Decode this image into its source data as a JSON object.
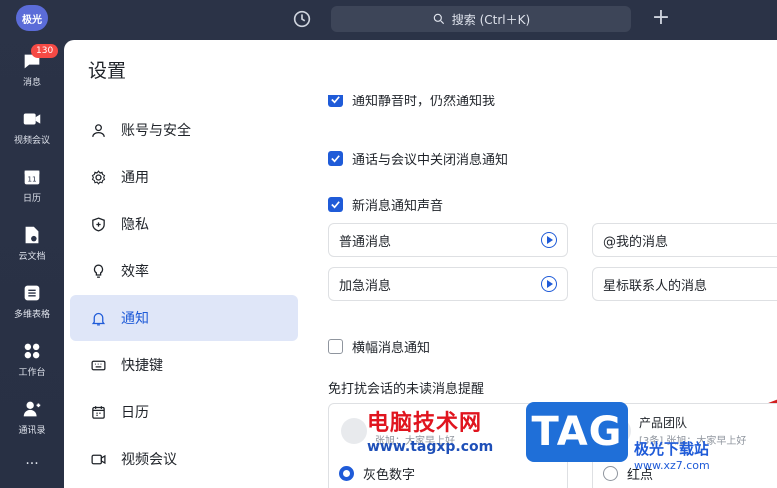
{
  "rail": {
    "avatar": "极光",
    "badge": "130",
    "items": [
      {
        "label": "消息",
        "icon": "chat-bubble-icon"
      },
      {
        "label": "视频会议",
        "icon": "video-camera-icon"
      },
      {
        "label": "日历",
        "icon": "calendar-icon"
      },
      {
        "label": "云文档",
        "icon": "cloud-doc-icon"
      },
      {
        "label": "多维表格",
        "icon": "table-icon"
      },
      {
        "label": "工作台",
        "icon": "grid-apps-icon"
      },
      {
        "label": "通讯录",
        "icon": "contacts-icon"
      },
      {
        "label": "···",
        "icon": "more-icon"
      }
    ]
  },
  "topbar": {
    "search_placeholder": "搜索 (Ctrl＋K)",
    "plus": "+"
  },
  "window": {
    "title": "设置",
    "nav": [
      {
        "label": "账号与安全",
        "icon": "person-icon"
      },
      {
        "label": "通用",
        "icon": "gear-icon"
      },
      {
        "label": "隐私",
        "icon": "shield-icon"
      },
      {
        "label": "效率",
        "icon": "bulb-icon"
      },
      {
        "label": "通知",
        "icon": "bell-icon",
        "active": true
      },
      {
        "label": "快捷键",
        "icon": "keyboard-icon"
      },
      {
        "label": "日历",
        "icon": "calendar-icon"
      },
      {
        "label": "视频会议",
        "icon": "video-camera-icon"
      }
    ],
    "content": {
      "option_cut": "通知静音时，仍然通知我",
      "option_call": "通话与会议中关闭消息通知",
      "option_sound": "新消息通知声音",
      "sounds": [
        "普通消息",
        "@我的消息",
        "加急消息",
        "星标联系人的消息"
      ],
      "option_banner": "横幅消息通知",
      "dnd_label": "免打扰会话的未读消息提醒",
      "preview1": {
        "name": "",
        "msg": "张旭：大家早上好"
      },
      "preview2": {
        "name": "产品团队",
        "msg": "[3条] 张旭：大家早上好"
      },
      "radio1": "灰色数字",
      "radio2": "红点"
    }
  },
  "watermark": {
    "cn": "电脑技术网",
    "url": "www.tagxp.com",
    "tag": "TAG",
    "site": "极光下载站",
    "site_url": "www.xz7.com"
  },
  "colors": {
    "accent": "#1f5bd8",
    "rail_bg": "#2b3347",
    "annotation_red": "#d21f1f"
  }
}
